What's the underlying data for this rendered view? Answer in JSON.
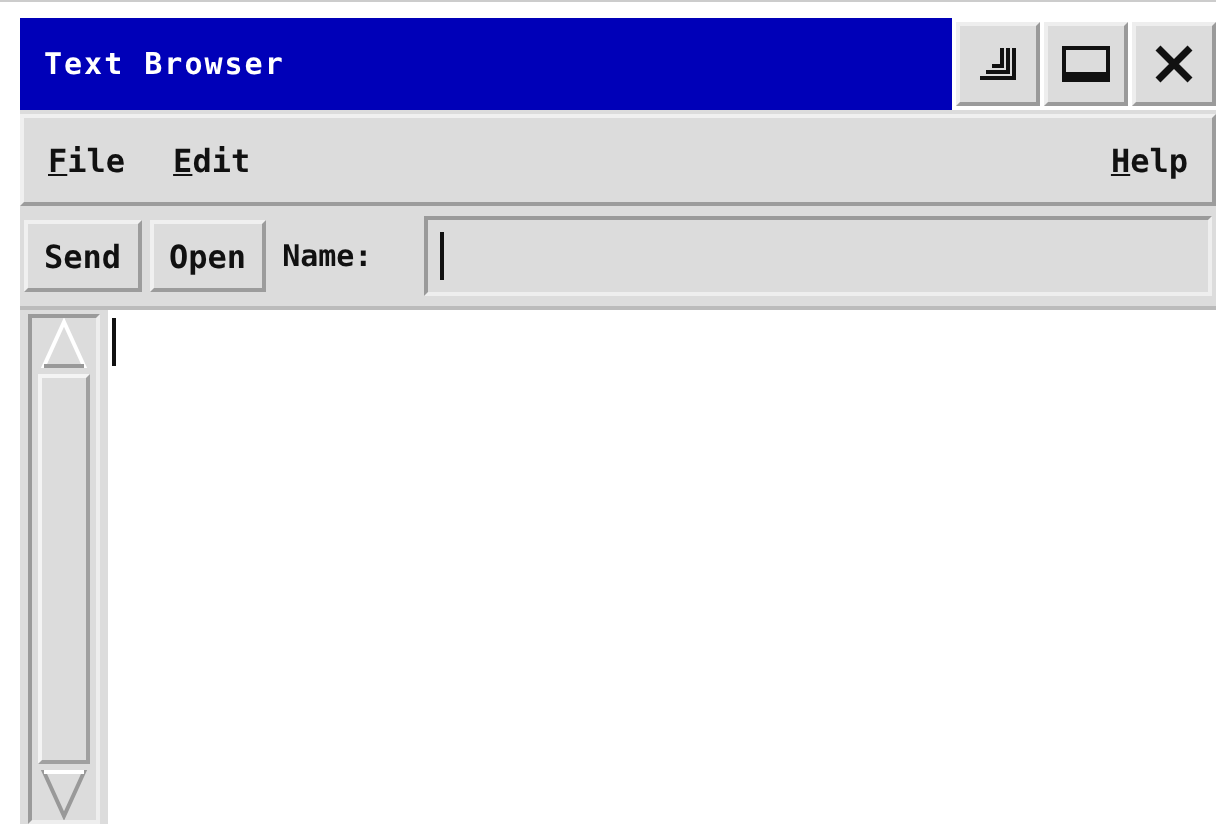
{
  "window": {
    "title": "Text Browser"
  },
  "menu": {
    "left": [
      "File",
      "Edit"
    ],
    "right": [
      "Help"
    ]
  },
  "toolbar": {
    "buttons": [
      "Send",
      "Open"
    ],
    "name_label": "Name:"
  }
}
